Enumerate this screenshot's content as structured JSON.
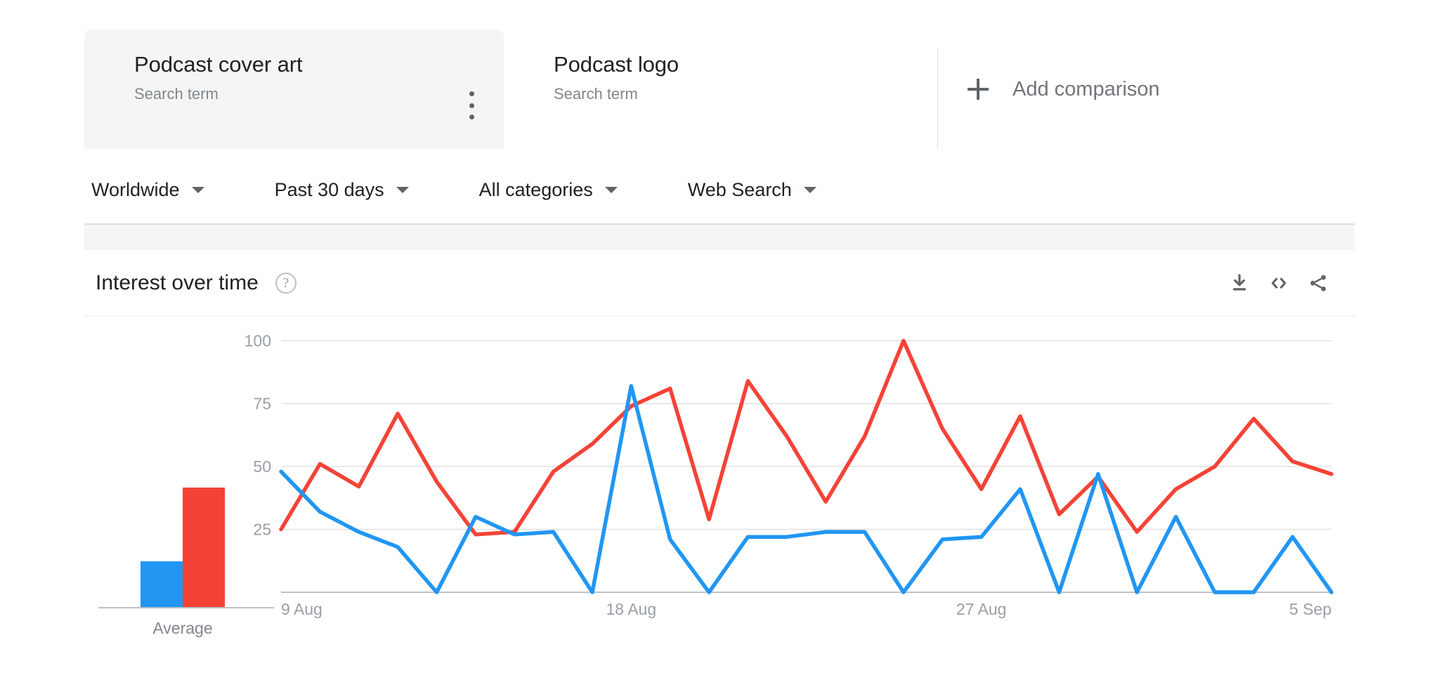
{
  "comparison": {
    "cards": [
      {
        "term": "Podcast cover art",
        "subtitle": "Search term",
        "color": "#4285f4",
        "menu_icon": "kebab-menu-icon"
      },
      {
        "term": "Podcast logo",
        "subtitle": "Search term",
        "color": "#ea4335"
      }
    ],
    "add_comparison_label": "Add comparison",
    "add_icon": "plus-icon"
  },
  "filters": [
    {
      "label": "Worldwide"
    },
    {
      "label": "Past 30 days"
    },
    {
      "label": "All categories"
    },
    {
      "label": "Web Search"
    }
  ],
  "section": {
    "title": "Interest over time",
    "help_icon": "help-question-icon",
    "actions": [
      {
        "name": "download-icon"
      },
      {
        "name": "embed-code-icon"
      },
      {
        "name": "share-icon"
      }
    ]
  },
  "chart_data": {
    "type": "line",
    "title": "Interest over time",
    "xlabel": "",
    "ylabel": "",
    "ylim": [
      0,
      100
    ],
    "yticks": [
      100,
      75,
      50,
      25
    ],
    "xticks": [
      "9 Aug",
      "18 Aug",
      "27 Aug",
      "5 Sep"
    ],
    "xtick_indices": [
      0,
      9,
      18,
      27
    ],
    "grid": true,
    "legend_position": "top",
    "x": [
      "9 Aug",
      "10 Aug",
      "11 Aug",
      "12 Aug",
      "13 Aug",
      "14 Aug",
      "15 Aug",
      "16 Aug",
      "17 Aug",
      "18 Aug",
      "19 Aug",
      "20 Aug",
      "21 Aug",
      "22 Aug",
      "23 Aug",
      "24 Aug",
      "25 Aug",
      "26 Aug",
      "27 Aug",
      "28 Aug",
      "29 Aug",
      "30 Aug",
      "31 Aug",
      "1 Sep",
      "2 Sep",
      "3 Sep",
      "4 Sep",
      "5 Sep"
    ],
    "series": [
      {
        "name": "Podcast cover art",
        "color": "#2196f3",
        "values": [
          48,
          32,
          24,
          18,
          0,
          30,
          23,
          24,
          0,
          82,
          21,
          0,
          22,
          22,
          24,
          24,
          0,
          21,
          22,
          41,
          0,
          47,
          0,
          30,
          0,
          0,
          22,
          0
        ]
      },
      {
        "name": "Podcast logo",
        "color": "#f44336",
        "values": [
          25,
          51,
          42,
          71,
          44,
          23,
          24,
          48,
          59,
          74,
          81,
          29,
          84,
          62,
          36,
          62,
          100,
          65,
          41,
          70,
          31,
          46,
          24,
          41,
          50,
          69,
          52,
          47
        ]
      }
    ],
    "average_bars": {
      "label": "Average",
      "type": "bar",
      "categories": [
        "Podcast cover art",
        "Podcast logo"
      ],
      "values": [
        19,
        50
      ],
      "colors": [
        "#2196f3",
        "#f44336"
      ]
    }
  }
}
